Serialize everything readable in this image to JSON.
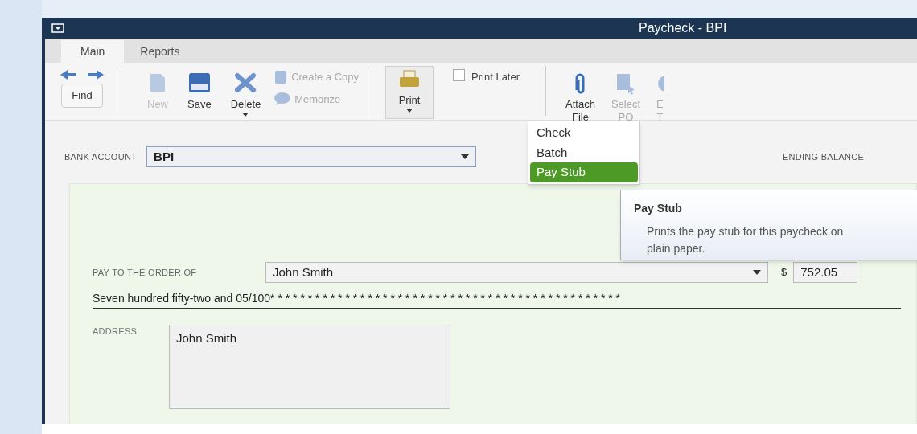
{
  "window": {
    "title": "Paycheck - BPI"
  },
  "tabs": [
    {
      "label": "Main",
      "selected": true
    },
    {
      "label": "Reports",
      "selected": false
    }
  ],
  "toolbar": {
    "find": "Find",
    "items": [
      {
        "kind": "new",
        "label": "New",
        "disabled": true
      },
      {
        "kind": "save",
        "label": "Save",
        "disabled": false
      },
      {
        "kind": "delete",
        "label": "Delete",
        "disabled": false
      }
    ],
    "copy": [
      {
        "kind": "copy",
        "label": "Create a Copy",
        "disabled": true
      },
      {
        "kind": "memorize",
        "label": "Memorize",
        "disabled": true
      }
    ],
    "print": {
      "label": "Print",
      "pressed": true
    },
    "print_later": {
      "label": "Print Later",
      "checked": false
    },
    "right": [
      {
        "kind": "attach",
        "label": "Attach\nFile",
        "disabled": false
      },
      {
        "kind": "select",
        "label": "Select\nPO",
        "disabled": true
      },
      {
        "kind": "cut",
        "label": "E\nT",
        "disabled": true
      }
    ]
  },
  "print_menu": [
    {
      "label": "Check",
      "selected": false
    },
    {
      "label": "Batch",
      "selected": false
    },
    {
      "label": "Pay Stub",
      "selected": true
    }
  ],
  "tooltip": {
    "title": "Pay Stub",
    "text": "Prints the pay stub for this paycheck on plain paper."
  },
  "bank_account": {
    "label": "BANK ACCOUNT",
    "value": "BPI"
  },
  "ending_balance_label": "ENDING BALANCE",
  "check": {
    "pay_to_label": "PAY TO THE ORDER OF",
    "payee": "John Smith",
    "currency": "$",
    "amount": "752.05",
    "amount_words": "Seven hundred fifty-two and 05/100* * * * * * * * * * * * * * * * * * * * * * * * * * * * * * * * * * * * * * * * * * * * * * *",
    "address_label": "ADDRESS",
    "address": "John Smith"
  }
}
